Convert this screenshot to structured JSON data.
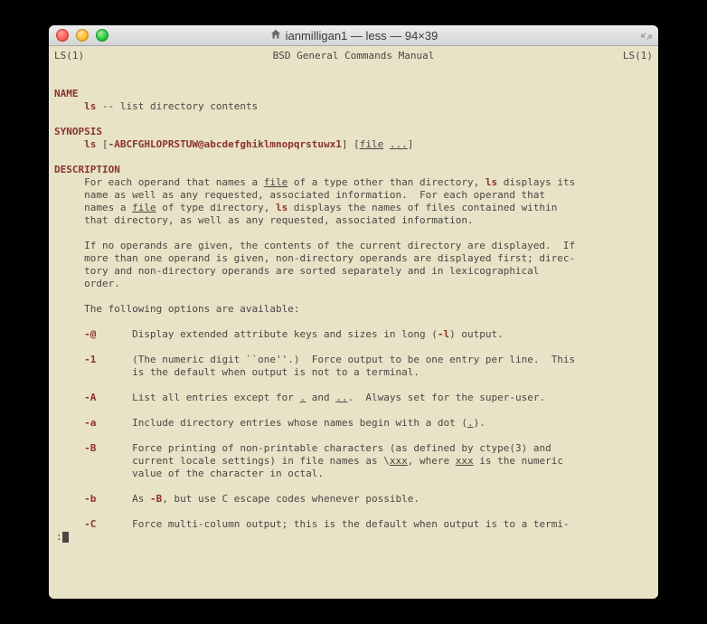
{
  "window": {
    "title": "ianmilligan1 — less — 94×39"
  },
  "man": {
    "header_left": "LS(1)",
    "header_center": "BSD General Commands Manual",
    "header_right": "LS(1)",
    "name_heading": "NAME",
    "name_cmd": "ls",
    "name_desc": " -- list directory contents",
    "synopsis_heading": "SYNOPSIS",
    "synopsis_cmd": "ls",
    "synopsis_flags": "-ABCFGHLOPRSTUW@abcdefghiklmnopqrstuwx1",
    "synopsis_file": "file",
    "synopsis_ellipsis": "...",
    "description_heading": "DESCRIPTION",
    "desc_p1_a": "     For each operand that names a ",
    "desc_file": "file",
    "desc_p1_b": " of a type other than directory, ",
    "desc_ls": "ls",
    "desc_p1_c": " displays its\n     name as well as any requested, associated information.  For each operand that\n     names a ",
    "desc_p1_d": " of type directory, ",
    "desc_p1_e": " displays the names of files contained within\n     that directory, as well as any requested, associated information.",
    "desc_p2": "     If no operands are given, the contents of the current directory are displayed.  If\n     more than one operand is given, non-directory operands are displayed first; direc-\n     tory and non-directory operands are sorted separately and in lexicographical\n     order.",
    "desc_p3": "     The following options are available:",
    "opt_at_flag": "-@",
    "opt_at_a": "      Display extended attribute keys and sizes in long (",
    "opt_at_l": "-l",
    "opt_at_b": ") output.",
    "opt_1_flag": "-1",
    "opt_1_text": "      (The numeric digit ``one''.)  Force output to be one entry per line.  This\n             is the default when output is not to a terminal.",
    "opt_A_flag": "-A",
    "opt_A_a": "      List all entries except for ",
    "opt_A_dot": ".",
    "opt_A_b": " and ",
    "opt_A_dotdot": "..",
    "opt_A_c": ".  Always set for the super-user.",
    "opt_a_flag": "-a",
    "opt_a_a": "      Include directory entries whose names begin with a dot (",
    "opt_a_dot": ".",
    "opt_a_b": ").",
    "opt_B_flag": "-B",
    "opt_B_a": "      Force printing of non-printable characters (as defined by ctype(3) and\n             current locale settings) in file names as \\",
    "opt_B_xxx1": "xxx",
    "opt_B_b": ", where ",
    "opt_B_xxx2": "xxx",
    "opt_B_c": " is the numeric\n             value of the character in octal.",
    "opt_b_flag": "-b",
    "opt_b_a": "      As ",
    "opt_b_B": "-B",
    "opt_b_b": ", but use C escape codes whenever possible.",
    "opt_C_flag": "-C",
    "opt_C_text": "      Force multi-column output; this is the default when output is to a termi-",
    "prompt": ":"
  }
}
